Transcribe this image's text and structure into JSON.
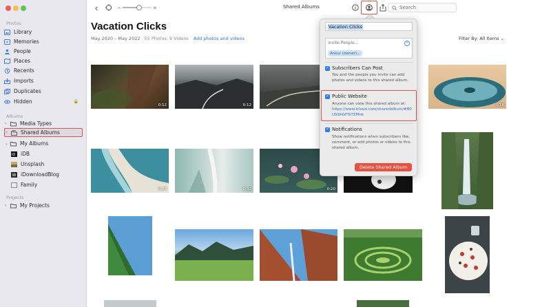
{
  "window": {
    "traffic_lights": [
      "#ee5d55",
      "#f4bd4f",
      "#5fc453"
    ]
  },
  "sidebar": {
    "sections": {
      "photos": "Photos",
      "albums": "Albums",
      "projects": "Projects"
    },
    "photos_items": [
      {
        "label": "Library",
        "icon": "photo-library-icon"
      },
      {
        "label": "Memories",
        "icon": "memories-icon"
      },
      {
        "label": "People",
        "icon": "people-icon"
      },
      {
        "label": "Places",
        "icon": "places-icon"
      },
      {
        "label": "Recents",
        "icon": "clock-icon"
      },
      {
        "label": "Imports",
        "icon": "import-icon"
      },
      {
        "label": "Duplicates",
        "icon": "duplicates-icon"
      },
      {
        "label": "Hidden",
        "icon": "hidden-icon"
      }
    ],
    "album_items": [
      {
        "label": "Media Types"
      },
      {
        "label": "Shared Albums"
      },
      {
        "label": "My Albums"
      },
      {
        "label": "iDB"
      },
      {
        "label": "Unsplash"
      },
      {
        "label": "iDownloadBlog"
      },
      {
        "label": "Family"
      }
    ],
    "project_items": [
      {
        "label": "My Projects"
      }
    ]
  },
  "toolbar": {
    "title": "Shared Albums",
    "search_placeholder": "Search"
  },
  "album": {
    "title": "Vacation Clicks",
    "date_range": "May 2020 – May 2022",
    "count": "55 Photos, 9 Videos",
    "add_link": "Add photos and videos",
    "filter_label": "Filter By:",
    "filter_value": "All Items"
  },
  "photos": [
    {
      "duration": "0:12"
    },
    {
      "duration": "0:12"
    },
    {
      "duration": ""
    },
    {
      "duration": "0:18"
    },
    {
      "duration": "0:27"
    },
    {
      "duration": "0:32"
    },
    {
      "duration": "0:20"
    },
    {
      "duration": ""
    },
    {
      "duration": ""
    },
    {
      "duration": ""
    },
    {
      "duration": ""
    },
    {
      "duration": ""
    },
    {
      "duration": ""
    },
    {
      "duration": ""
    }
  ],
  "popover": {
    "album_name": "Vacation Clicks",
    "invite_placeholder": "Invite People...",
    "owner_token": "Ankur (owner)",
    "subscribers_title": "Subscribers Can Post",
    "subscribers_desc": "You and the people you invite can add photos and videos to this shared album.",
    "public_title": "Public Website",
    "public_desc": "Anyone can view this shared album at:",
    "public_link": "https://www.icloud.com/sharedalbum/#B0US9XGFTsTZMnk",
    "notifications_title": "Notifications",
    "notifications_desc": "Show notifications when subscribers like, comment, or add photos or videos to this shared album.",
    "delete_label": "Delete Shared Album"
  },
  "colors": {
    "highlight": "#d9534f",
    "accent": "#2f7bf5",
    "delete": "#e8513f"
  }
}
